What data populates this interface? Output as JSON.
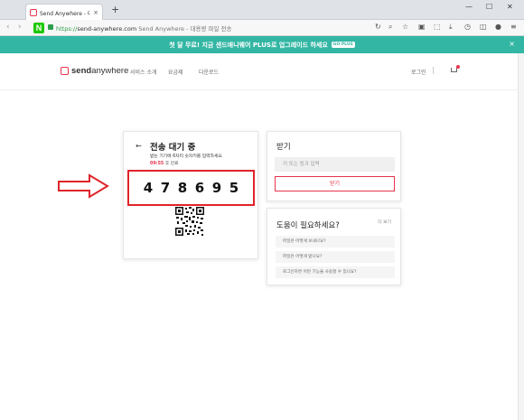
{
  "browser": {
    "tab_title": "Send Anywhere - 대용량",
    "tab_close": "×",
    "new_tab": "+",
    "url_protocol": "https://",
    "url_domain": "send-anywhere.com",
    "url_page_title": "Send Anywhere - 대용량 파일 전송",
    "back_glyph": "‹",
    "forward_glyph": "›",
    "reload_glyph": "↻",
    "naver_logo": "N",
    "win_min": "—",
    "win_max": "☐",
    "win_close": "✕"
  },
  "banner": {
    "text": "첫 달 무료! 지금 샌드애니웨어 PLUS로 업그레이드 하세요",
    "badge": "GO PLUS",
    "close": "×",
    "color": "#33b6a4"
  },
  "header": {
    "logo_bold": "send",
    "logo_light": "anywhere",
    "nav": [
      "서비스 소개",
      "요금제",
      "다운로드"
    ],
    "login": "로그인"
  },
  "wait": {
    "back": "←",
    "title": "전송 대기 중",
    "desc": "받는 기기에 6자리 숫자키를 입력하세요",
    "timer": "09:55",
    "timer_suffix": "후 만료",
    "digits": [
      "4",
      "7",
      "8",
      "6",
      "9",
      "5"
    ]
  },
  "receive": {
    "title": "받기",
    "placeholder": "키 또는 링크 입력",
    "button": "받기"
  },
  "help": {
    "title": "도움이 필요하세요?",
    "more": "더 보기",
    "items": [
      "파일은 어떻게 보내나요?",
      "파일은 어떻게 받나요?",
      "로그인하면 어떤 기능을 사용할 수 있나요?"
    ]
  },
  "colors": {
    "accent": "#e8344e",
    "highlight_box": "#e0242a"
  }
}
